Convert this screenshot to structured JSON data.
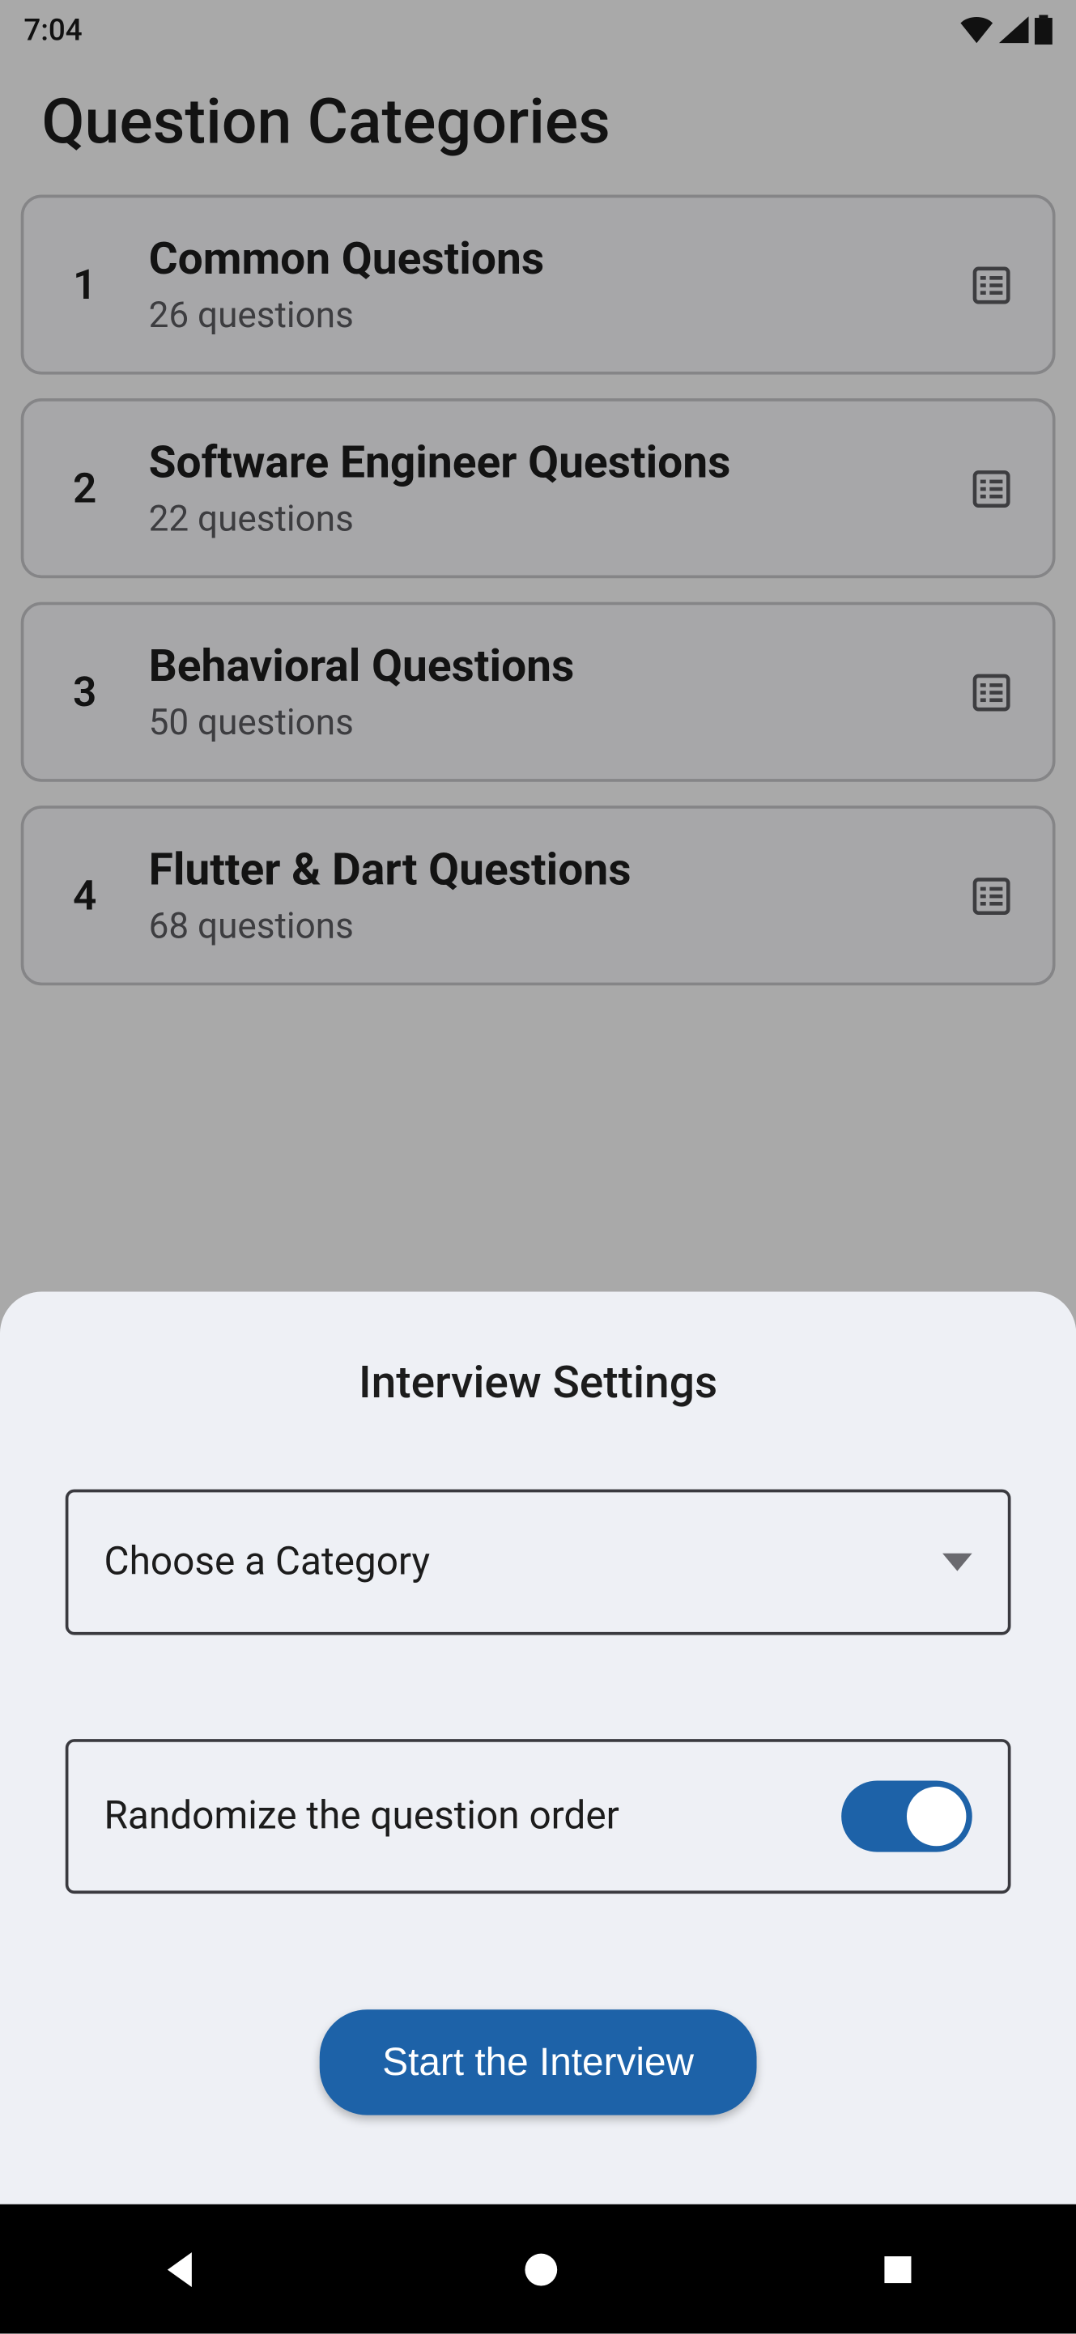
{
  "status": {
    "time": "7:04"
  },
  "page": {
    "title": "Question Categories"
  },
  "categories": [
    {
      "num": "1",
      "title": "Common Questions",
      "sub": "26 questions"
    },
    {
      "num": "2",
      "title": "Software Engineer Questions",
      "sub": "22 questions"
    },
    {
      "num": "3",
      "title": "Behavioral Questions",
      "sub": "50 questions"
    },
    {
      "num": "4",
      "title": "Flutter & Dart Questions",
      "sub": "68 questions"
    }
  ],
  "sheet": {
    "title": "Interview Settings",
    "dropdown_placeholder": "Choose a Category",
    "randomize_label": "Randomize the question order",
    "randomize_on": true,
    "start_label": "Start the Interview"
  }
}
